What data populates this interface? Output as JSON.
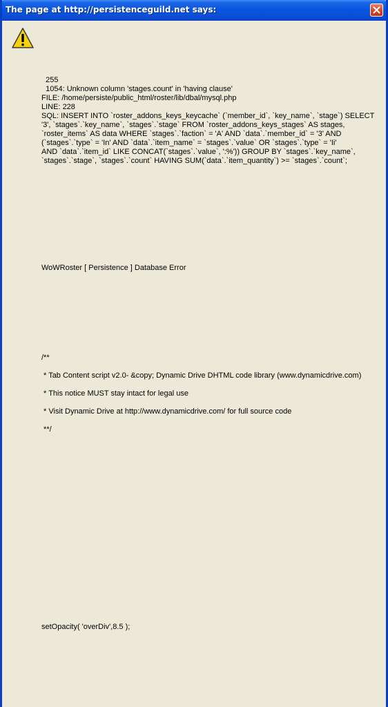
{
  "dialog": {
    "title": "The page at http://persistenceguild.net says:",
    "close_icon": "close-icon",
    "warning_icon": "warning-icon"
  },
  "message": {
    "error_code_line": "  255",
    "error_desc_line": "  1054: Unknown column 'stages.count' in 'having clause'",
    "file_line": "FILE: /home/persiste/public_html/roster/lib/dbal/mysql.php",
    "line_line": "LINE: 228",
    "sql_lines": [
      "SQL: INSERT INTO `roster_addons_keys_keycache` (`member_id`, `key_name`, `stage`) SELECT",
      "'3', `stages`.`key_name`, `stages`.`stage` FROM `roster_addons_keys_stages` AS stages,",
      "`roster_items` AS data WHERE `stages`.`faction` = 'A' AND `data`.`member_id` = '3' AND",
      "(`stages`.`type` = 'In' AND `data`.`item_name` = `stages`.`value` OR `stages`.`type` = 'Ii'",
      "AND `data`.`item_id` LIKE CONCAT(`stages`.`value`, ':%')) GROUP BY `stages`.`key_name`,",
      "`stages`.`stage`, `stages`.`count` HAVING SUM(`data`.`item_quantity`) >= `stages`.`count`;"
    ],
    "db_error_line": "WoWRoster [ Persistence ] Database Error",
    "script_comment_lines": [
      "/**",
      " * Tab Content script v2.0- &copy; Dynamic Drive DHTML code library (www.dynamicdrive.com)",
      " * This notice MUST stay intact for legal use",
      " * Visit Dynamic Drive at http://www.dynamicdrive.com/ for full source code",
      " **/"
    ],
    "set_opacity_line": "setOpacity( 'overDiv',8.5 );"
  }
}
